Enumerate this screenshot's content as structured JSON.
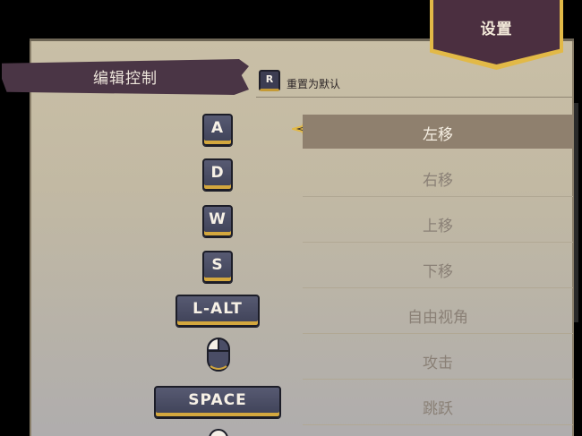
{
  "settings_tab": {
    "title": "设置"
  },
  "section": {
    "title": "编辑控制"
  },
  "reset": {
    "key": "R",
    "label": "重置为默认"
  },
  "bindings": [
    {
      "key": "A",
      "action": "左移",
      "selected": true
    },
    {
      "key": "D",
      "action": "右移",
      "selected": false
    },
    {
      "key": "W",
      "action": "上移",
      "selected": false
    },
    {
      "key": "S",
      "action": "下移",
      "selected": false
    },
    {
      "key": "L-ALT",
      "action": "自由视角",
      "selected": false
    },
    {
      "key": "mouse-left-icon",
      "action": "攻击",
      "selected": false
    },
    {
      "key": "SPACE",
      "action": "跳跃",
      "selected": false
    }
  ],
  "colors": {
    "accent_gold": "#d3a73e",
    "tab_purple": "#4b2f40",
    "key_blue": "#3e4157",
    "selected_row": "#8f806e"
  }
}
